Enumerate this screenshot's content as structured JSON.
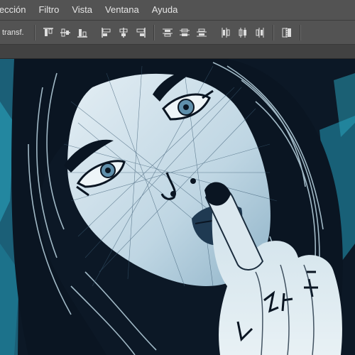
{
  "menu": {
    "items": [
      {
        "label": "lección"
      },
      {
        "label": "Filtro"
      },
      {
        "label": "Vista"
      },
      {
        "label": "Ventana"
      },
      {
        "label": "Ayuda"
      }
    ]
  },
  "options": {
    "transform_label": "transf.",
    "align_group": [
      {
        "icon": "align-top-edges-icon"
      },
      {
        "icon": "align-vertical-centers-icon"
      },
      {
        "icon": "align-bottom-edges-icon"
      }
    ],
    "align_group2": [
      {
        "icon": "align-left-edges-icon"
      },
      {
        "icon": "align-horizontal-centers-icon"
      },
      {
        "icon": "align-right-edges-icon"
      }
    ],
    "distribute_group": [
      {
        "icon": "distribute-top-icon"
      },
      {
        "icon": "distribute-vcenter-icon"
      },
      {
        "icon": "distribute-bottom-icon"
      }
    ],
    "distribute_group2": [
      {
        "icon": "distribute-left-icon"
      },
      {
        "icon": "distribute-hcenter-icon"
      },
      {
        "icon": "distribute-right-icon"
      }
    ],
    "auto_align": {
      "icon": "auto-align-layers-icon"
    }
  },
  "colors": {
    "ui_bg": "#535353",
    "canvas_bg": "#0d1d2e",
    "skin": "#c9dde8",
    "hair": "#0a1522",
    "accent_teal": "#2aa7c2"
  }
}
